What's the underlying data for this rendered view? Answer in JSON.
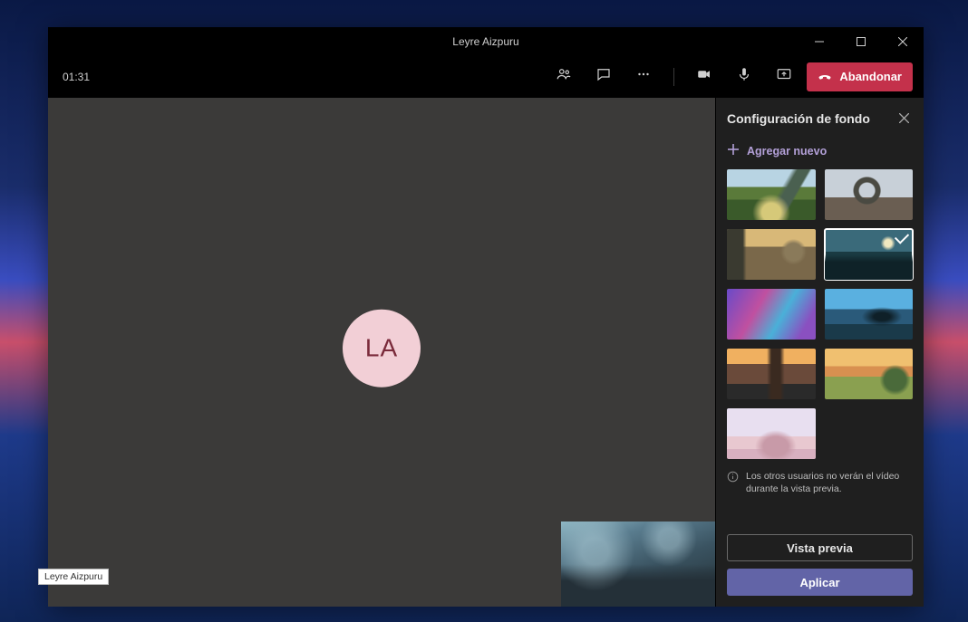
{
  "titlebar": {
    "title": "Leyre Aizpuru"
  },
  "toolbar": {
    "call_time": "01:31",
    "icons": {
      "people": "people-icon",
      "chat": "chat-icon",
      "more": "more-icon",
      "camera": "camera-icon",
      "mic": "mic-icon",
      "share": "share-screen-icon"
    },
    "leave_label": "Abandonar"
  },
  "stage": {
    "avatar_initials": "LA",
    "tooltip_name": "Leyre Aizpuru"
  },
  "panel": {
    "title": "Configuración de fondo",
    "add_new_label": "Agregar nuevo",
    "info_text": "Los otros usuarios no verán el vídeo durante la vista previa.",
    "preview_label": "Vista previa",
    "apply_label": "Aplicar",
    "selected_index": 3,
    "backgrounds": [
      {
        "name": "valley-landscape"
      },
      {
        "name": "stone-gate"
      },
      {
        "name": "desert-town"
      },
      {
        "name": "sci-fi-coast"
      },
      {
        "name": "nebula"
      },
      {
        "name": "tropical-overlook"
      },
      {
        "name": "sunset-street"
      },
      {
        "name": "cartoon-desert"
      },
      {
        "name": "pink-dunes"
      }
    ]
  }
}
